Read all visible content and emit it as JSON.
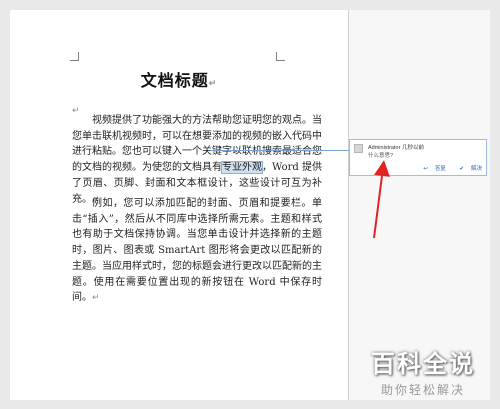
{
  "document": {
    "title": "文档标题",
    "para1_before": "视频提供了功能强大的方法帮助您证明您的观点。当您单击联机视频时，可以在想要添加的视频的嵌入代码中进行粘贴。您也可以键入一个关键字以联机搜索最适合您的文档的视频。为使您的文档具有",
    "para1_highlight": "专业外观",
    "para1_after": "，Word 提供了页眉、页脚、封面和文本框设计，这些设计可互为补充。",
    "para2": "例如，您可以添加匹配的封面、页眉和提要栏。单击“插入”，然后从不同库中选择所需元素。主题和样式也有助于文档保持协调。当您单击设计并选择新的主题时，图片、图表或 SmartArt 图形将会更改以匹配新的主题。当应用样式时，您的标题会进行更改以匹配新的主题。使用在需要位置出现的新按钮在 Word 中保存时间。",
    "paragraph_mark": "↵"
  },
  "comment": {
    "author": "Administrator",
    "time": "几秒以前",
    "text": "什么意思?",
    "reply_label": "答复",
    "resolve_label": "解决"
  },
  "watermark": {
    "main": "百科全说",
    "sub": "助你轻松解决"
  },
  "colors": {
    "arrow": "#e02424",
    "highlight": "#cfe0f1",
    "comment_border": "#9fbde3"
  }
}
